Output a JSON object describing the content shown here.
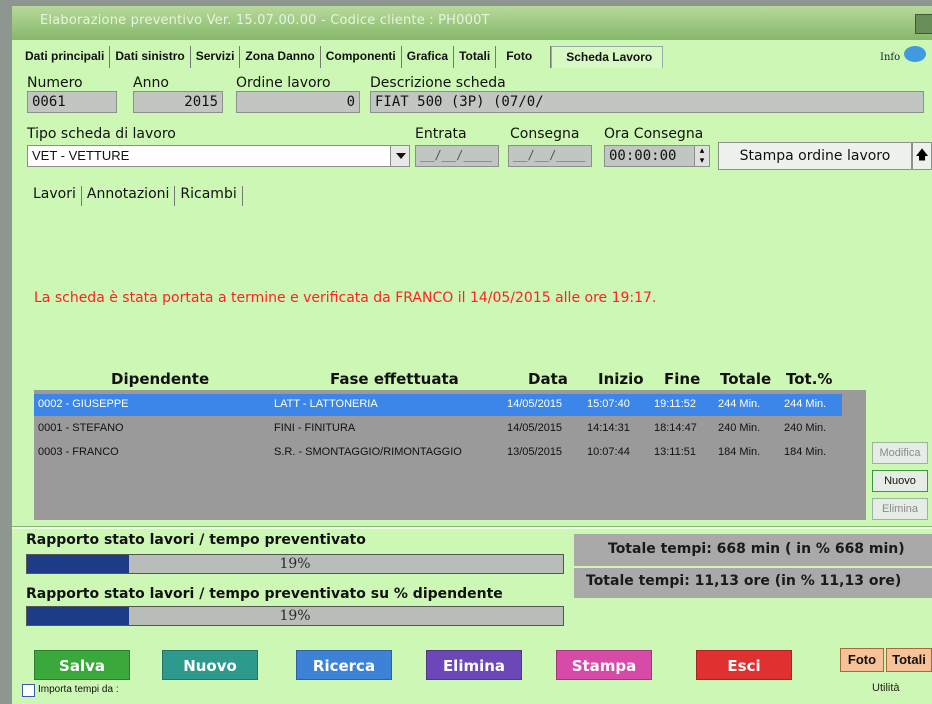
{
  "window": {
    "title": "Elaborazione preventivo Ver. 15.07.00.00 - Codice cliente : PH000T"
  },
  "tabs": [
    {
      "label": "Dati principali"
    },
    {
      "label": "Dati sinistro"
    },
    {
      "label": "Servizi"
    },
    {
      "label": "Zona Danno"
    },
    {
      "label": "Componenti"
    },
    {
      "label": "Grafica"
    },
    {
      "label": "Totali"
    },
    {
      "label": "Foto"
    },
    {
      "label": "Scheda Lavoro"
    }
  ],
  "info_label": "Info",
  "header": {
    "numero_label": "Numero",
    "numero_value": "0061",
    "anno_label": "Anno",
    "anno_value": "2015",
    "ordine_label": "Ordine lavoro",
    "ordine_value": "0",
    "descr_label": "Descrizione scheda",
    "descr_value": "FIAT  500 (3P) (07/0/"
  },
  "tipo": {
    "label": "Tipo scheda di lavoro",
    "value": "VET - VETTURE",
    "entrata_label": "Entrata",
    "entrata_value": "__/__/____",
    "consegna_label": "Consegna",
    "consegna_value": "__/__/____",
    "ora_label": "Ora Consegna",
    "ora_value": "00:00:00",
    "stampa_btn": "Stampa ordine lavoro"
  },
  "subtabs": [
    {
      "label": "Lavori"
    },
    {
      "label": "Annotazioni"
    },
    {
      "label": "Ricambi"
    }
  ],
  "message": "La scheda è stata portata a termine e verificata da  FRANCO il 14/05/2015 alle ore 19:17.",
  "grid": {
    "headers": [
      "Dipendente",
      "Fase effettuata",
      "Data",
      "Inizio",
      "Fine",
      "Totale",
      "Tot.%"
    ],
    "rows": [
      [
        "0002 - GIUSEPPE",
        "LATT - LATTONERIA",
        "14/05/2015",
        "15:07:40",
        "19:11:52",
        "244 Min.",
        "244 Min."
      ],
      [
        "0001 - STEFANO",
        "FINI - FINITURA",
        "14/05/2015",
        "14:14:31",
        "18:14:47",
        "240 Min.",
        "240 Min."
      ],
      [
        "0003 - FRANCO",
        "S.R. - SMONTAGGIO/RIMONTAGGIO",
        "13/05/2015",
        "10:07:44",
        "13:11:51",
        "184 Min.",
        "184 Min."
      ]
    ]
  },
  "side_buttons": {
    "modifica": "Modifica",
    "nuovo": "Nuovo",
    "elimina": "Elimina"
  },
  "stats": {
    "bar1_label": "Rapporto stato lavori / tempo preventivato",
    "bar1_pct": "19%",
    "bar1_fraction": 0.19,
    "bar2_label": "Rapporto stato lavori / tempo preventivato su % dipendente",
    "bar2_pct": "19%",
    "bar2_fraction": 0.19,
    "totale_min": "Totale tempi: 668 min ( in % 668 min)",
    "totale_ore": "Totale tempi: 11,13 ore (in % 11,13 ore)"
  },
  "bottom": {
    "salva": "Salva",
    "nuovo": "Nuovo",
    "ricerca": "Ricerca",
    "elimina": "Elimina",
    "stampa": "Stampa",
    "esci": "Esci",
    "foto": "Foto",
    "totali": "Totali",
    "utilita": "Utilità",
    "importa_label": "Importa tempi da :"
  },
  "colors": {
    "window_bg": "#cdf7b4",
    "selected_row": "#3b86e8",
    "message": "#ff2222",
    "bar_fill": "#1c3c88"
  }
}
